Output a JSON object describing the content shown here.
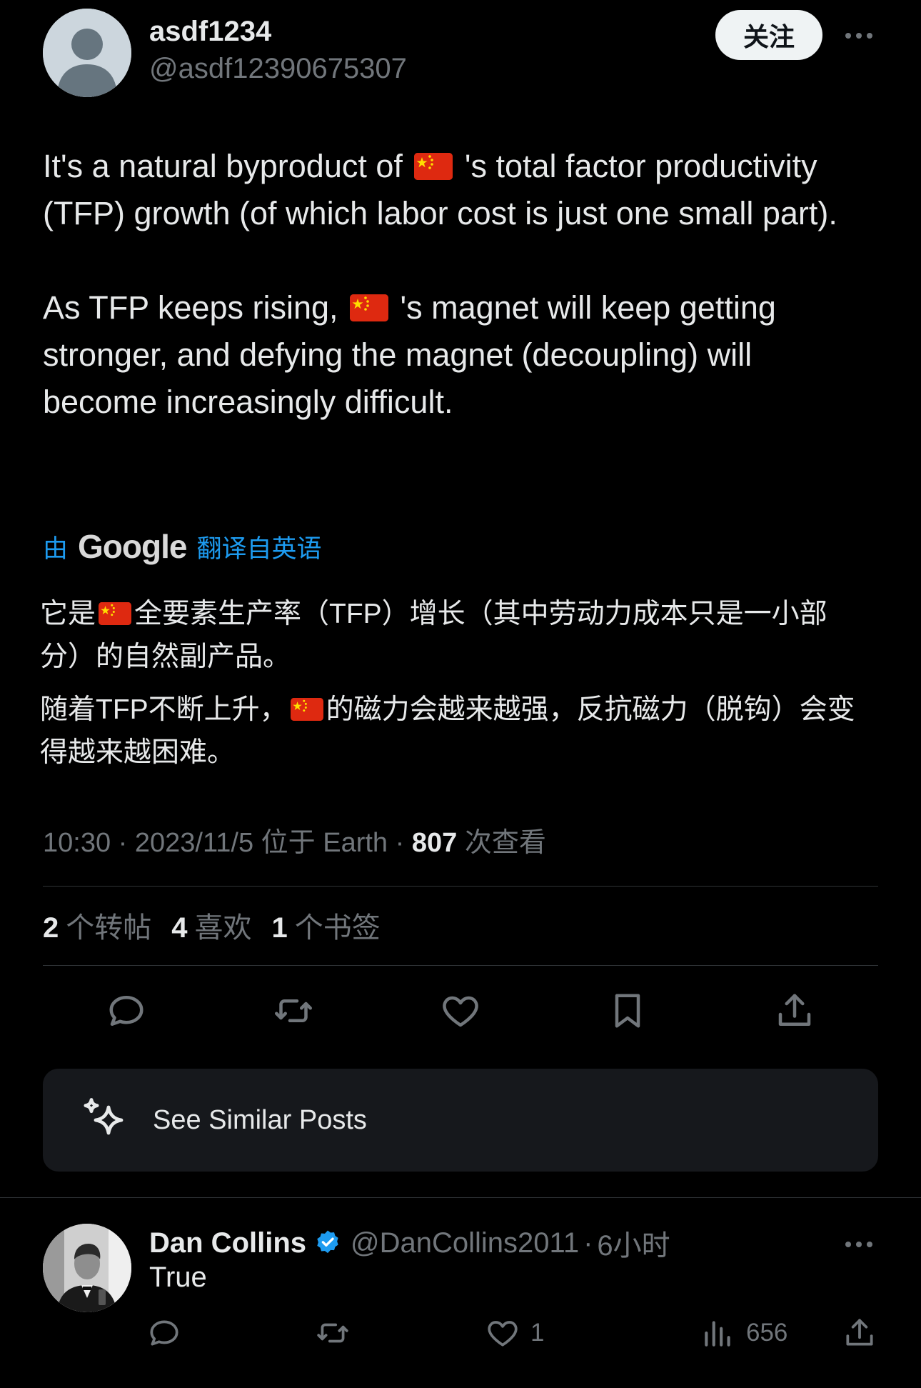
{
  "post": {
    "display_name": "asdf1234",
    "handle": "@asdf12390675307",
    "follow_label": "关注",
    "avatar_icon": "default-avatar-icon",
    "more_icon": "more-icon",
    "paragraph1": {
      "before_flag": "It's a natural byproduct of ",
      "flag": "china-flag-emoji",
      "after_flag": " 's total factor productivity (TFP) growth (of which labor cost is just one small part)."
    },
    "paragraph2": {
      "before_flag": "As TFP keeps rising, ",
      "flag": "china-flag-emoji",
      "after_flag": " 's magnet will keep getting stronger, and defying the magnet (decoupling) will become increasingly difficult."
    }
  },
  "translation": {
    "by_label": "由",
    "google_label": "Google",
    "from_label": "翻译自英语",
    "paragraph1": {
      "before_flag": "它是",
      "after_flag": "全要素生产率（TFP）增长（其中劳动力成本只是一小部分）的自然副产品。"
    },
    "paragraph2": {
      "before_flag": "随着TFP不断上升，",
      "after_flag": "的磁力会越来越强，反抗磁力（脱钩）会变得越来越困难。"
    }
  },
  "meta": {
    "time": "10:30",
    "date": "2023/11/5",
    "location": "位于 Earth",
    "views_count": "807",
    "views_label": "次查看",
    "separator": "·"
  },
  "stats": {
    "reposts_count": "2",
    "reposts_label": "个转帖",
    "likes_count": "4",
    "likes_label": "喜欢",
    "bookmarks_count": "1",
    "bookmarks_label": "个书签"
  },
  "actions": [
    "reply-icon",
    "repost-icon",
    "like-icon",
    "bookmark-icon",
    "share-icon"
  ],
  "similar_posts": {
    "label": "See Similar Posts",
    "icon": "sparkle-icon"
  },
  "reply": {
    "display_name": "Dan Collins",
    "handle": "@DanCollins2011",
    "separator": "·",
    "time_ago": "6小时",
    "text": "True",
    "likes": "1",
    "views": "656",
    "verified_icon": "verified-badge-icon"
  },
  "colors": {
    "background": "#000000",
    "text": "#e7e9ea",
    "muted": "#71767b",
    "accent": "#1d9bf0",
    "divider": "#2f3336",
    "card": "#16181c"
  }
}
